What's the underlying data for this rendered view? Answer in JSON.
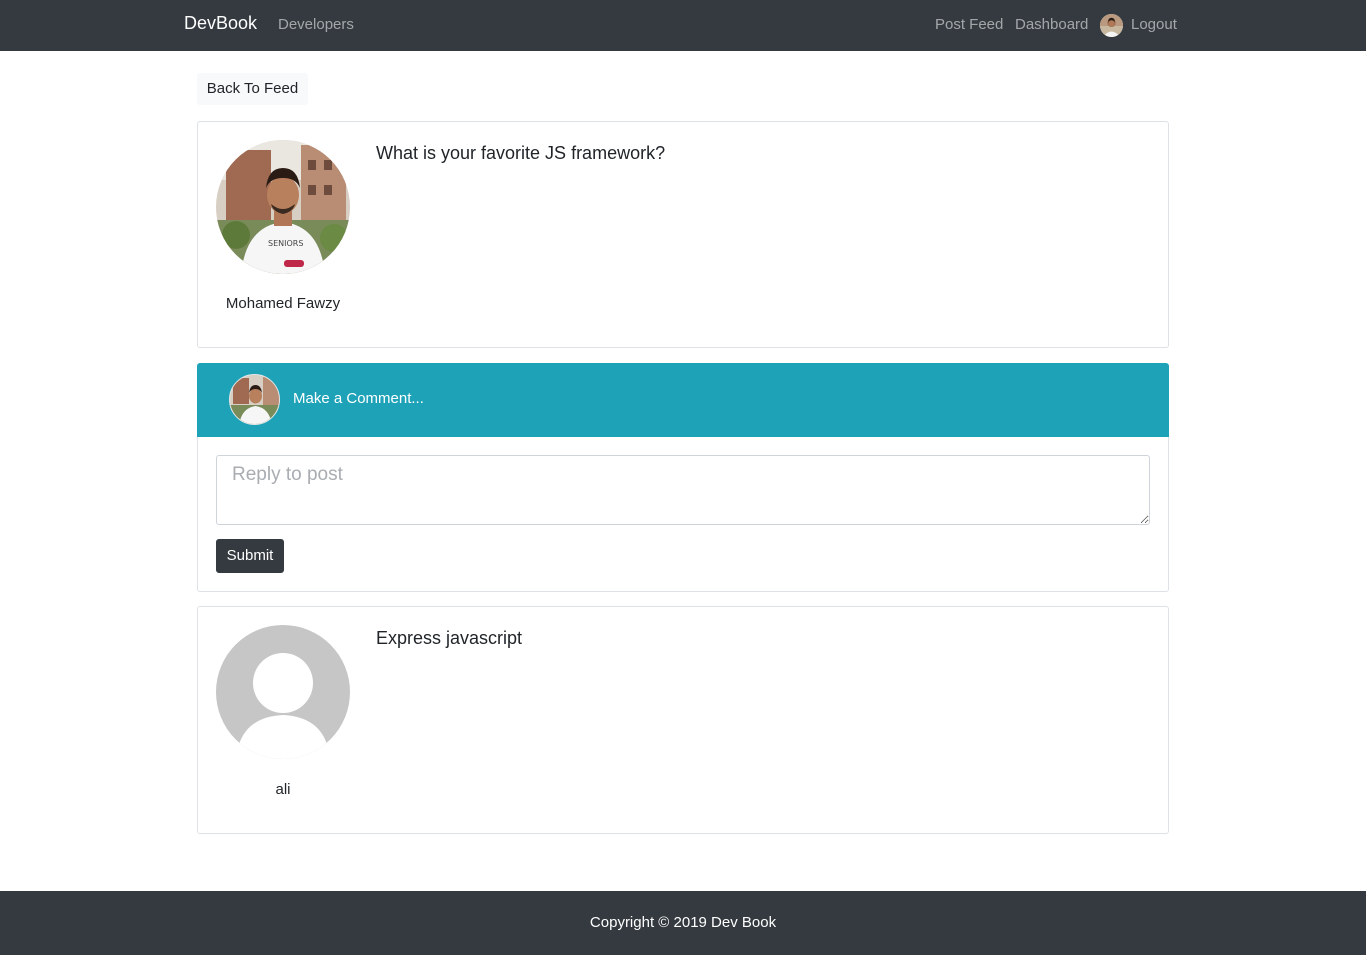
{
  "navbar": {
    "brand": "DevBook",
    "developers": "Developers",
    "post_feed": "Post Feed",
    "dashboard": "Dashboard",
    "logout": "Logout",
    "background": "#343a40"
  },
  "back_button": "Back To Feed",
  "post": {
    "author": "Mohamed Fawzy",
    "text": "What is your favorite JS framework?"
  },
  "comment_form": {
    "header": "Make a Comment...",
    "placeholder": "Reply to post",
    "submit": "Submit",
    "header_color": "#1ea2b8"
  },
  "comments": [
    {
      "author": "ali",
      "text": "Express javascript"
    }
  ],
  "footer": {
    "copyright": "Copyright © 2019 Dev Book"
  }
}
